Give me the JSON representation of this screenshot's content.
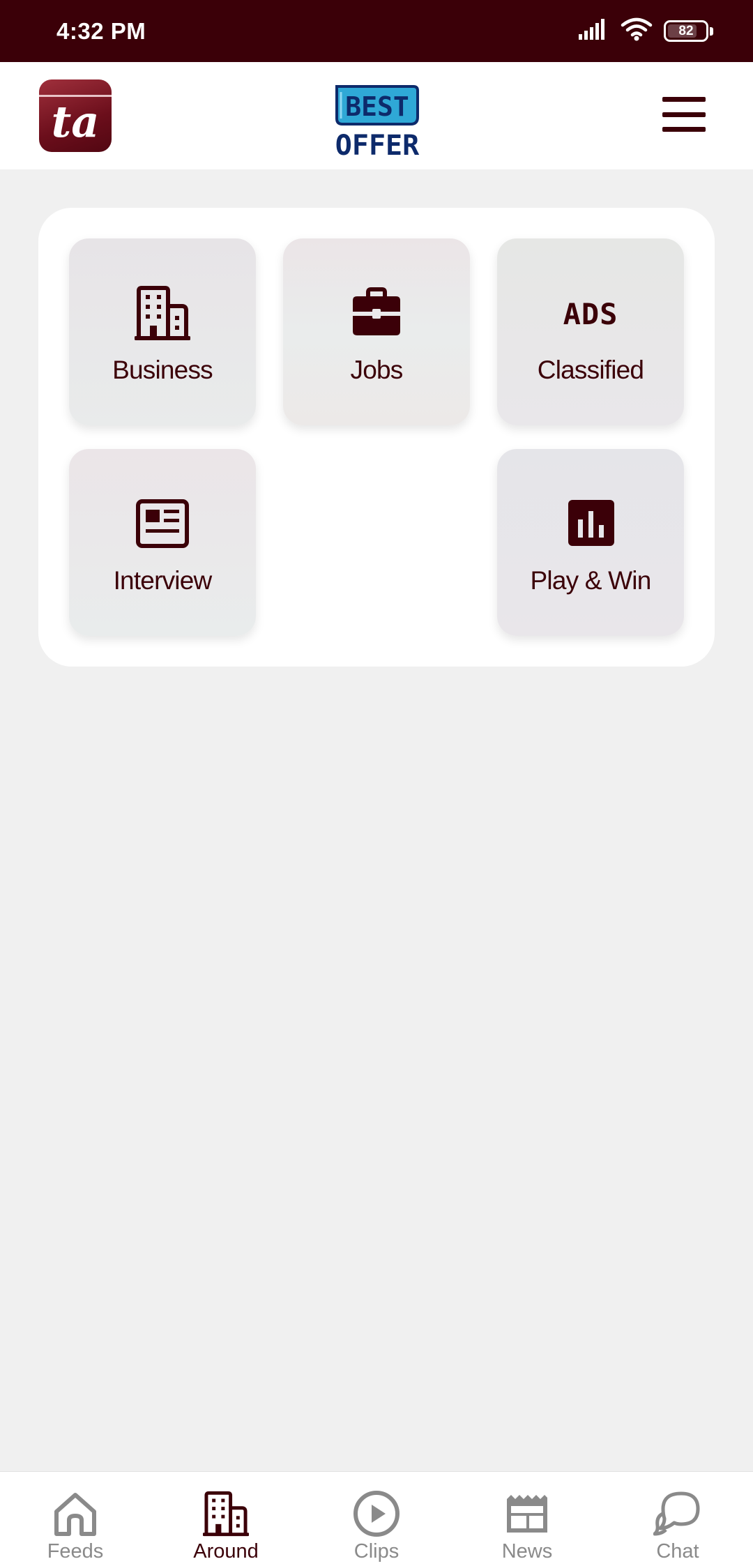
{
  "status_bar": {
    "time": "4:32 PM",
    "battery_level": "82",
    "icons": [
      "signal-icon",
      "wifi-icon",
      "battery-icon"
    ]
  },
  "app_bar": {
    "app_logo_text": "ta",
    "center_logo": {
      "line1": "BEST",
      "line2": "OFFER"
    },
    "menu_icon": "hamburger-menu-icon"
  },
  "grid": {
    "items": [
      {
        "label": "Business",
        "icon": "building-icon"
      },
      {
        "label": "Jobs",
        "icon": "briefcase-icon"
      },
      {
        "label": "Classified",
        "icon": "ads-icon",
        "icon_text": "ADS"
      },
      {
        "label": "Interview",
        "icon": "newspaper-icon"
      },
      {
        "label": "Play & Win",
        "icon": "bar-chart-icon"
      }
    ]
  },
  "bottom_nav": {
    "active": "Around",
    "items": [
      {
        "label": "Feeds",
        "icon": "home-icon"
      },
      {
        "label": "Around",
        "icon": "building-icon"
      },
      {
        "label": "Clips",
        "icon": "play-circle-icon"
      },
      {
        "label": "News",
        "icon": "newspaper-icon"
      },
      {
        "label": "Chat",
        "icon": "chat-bubble-icon"
      }
    ]
  },
  "colors": {
    "primary": "#3b0008",
    "background": "#f0f0f0",
    "inactive": "#8a8a8a",
    "offer_blue": "#2fa8d6",
    "offer_navy": "#0d2a6b"
  }
}
